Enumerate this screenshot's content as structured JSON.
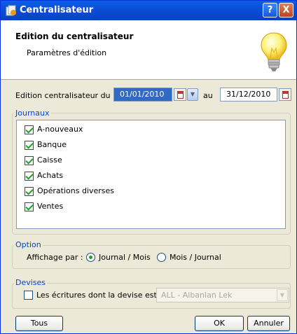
{
  "window": {
    "title": "Centralisateur",
    "help_label": "?",
    "close_label": "X"
  },
  "header": {
    "title": "Edition du centralisateur",
    "subtitle": "Paramètres d'édition"
  },
  "dates": {
    "label_from": "Edition centralisateur du :",
    "from": "01/01/2010",
    "label_to": "au",
    "to": "31/12/2010"
  },
  "journaux": {
    "legend": "Journaux",
    "items": [
      {
        "label": "A-nouveaux",
        "checked": true
      },
      {
        "label": "Banque",
        "checked": true
      },
      {
        "label": "Caisse",
        "checked": true
      },
      {
        "label": "Achats",
        "checked": true
      },
      {
        "label": "Opérations diverses",
        "checked": true
      },
      {
        "label": "Ventes",
        "checked": true
      }
    ]
  },
  "option": {
    "legend": "Option",
    "label": "Affichage par :",
    "choice1": "Journal / Mois",
    "choice2": "Mois / Journal",
    "selected": "Journal / Mois"
  },
  "devises": {
    "legend": "Devises",
    "checkbox_label": "Les écritures dont la devise est :",
    "checked": false,
    "currency": "ALL - Albanian Lek"
  },
  "buttons": {
    "tous": "Tous",
    "ok": "OK",
    "annuler": "Annuler"
  }
}
